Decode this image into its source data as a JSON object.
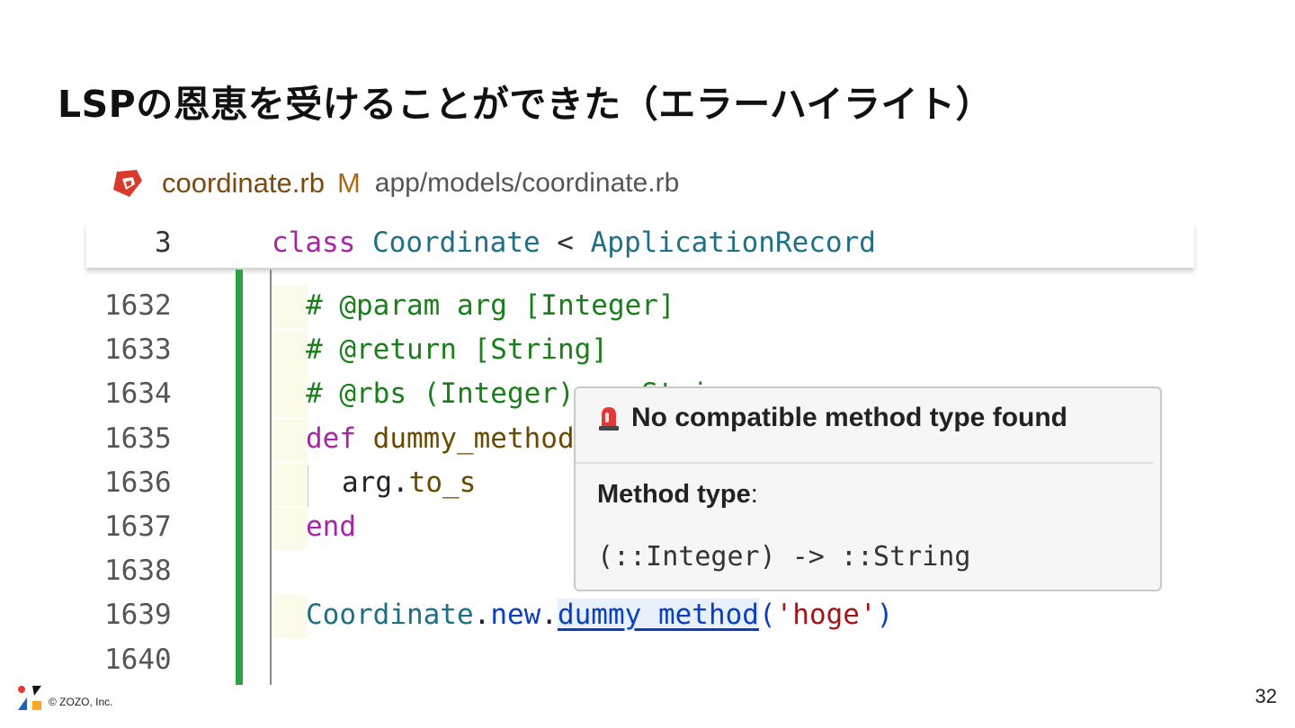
{
  "slide": {
    "title": "LSPの恩恵を受けることができた（エラーハイライト）",
    "page_number": "32",
    "copyright": "© ZOZO, Inc."
  },
  "editor": {
    "tab": {
      "file_name": "coordinate.rb",
      "status": "M",
      "path": "app/models/coordinate.rb",
      "icon": "ruby-icon"
    },
    "sticky": {
      "line_number": "3",
      "kw": "class",
      "class_name": "Coordinate",
      "op": " < ",
      "parent": "ApplicationRecord"
    },
    "line_numbers": [
      "1632",
      "1633",
      "1634",
      "1635",
      "1636",
      "1637",
      "1638",
      "1639",
      "1640"
    ],
    "lines": {
      "l1632": "# @param arg [Integer]",
      "l1633": "# @return [String]",
      "l1634": "# @rbs (Integer) -> String",
      "l1635_kw": "def",
      "l1635_name": " dummy_method(arg)",
      "l1636_recv": "arg.",
      "l1636_meth": "to_s",
      "l1637": "end",
      "l1639_cls": "Coordinate",
      "l1639_dot1": ".",
      "l1639_new": "new",
      "l1639_dot2": ".",
      "l1639_meth": "dummy_method",
      "l1639_open": "(",
      "l1639_str": "'hoge'",
      "l1639_close": ")"
    },
    "colors": {
      "keyword": "#a626a4",
      "class": "#1f6f86",
      "comment": "#1a7f1a",
      "change_bar": "#2ea043"
    }
  },
  "hover": {
    "icon": "siren-icon",
    "title": "No compatible method type found",
    "label": "Method type",
    "label_suffix": ":",
    "signature": "(::Integer) -> ::String"
  }
}
